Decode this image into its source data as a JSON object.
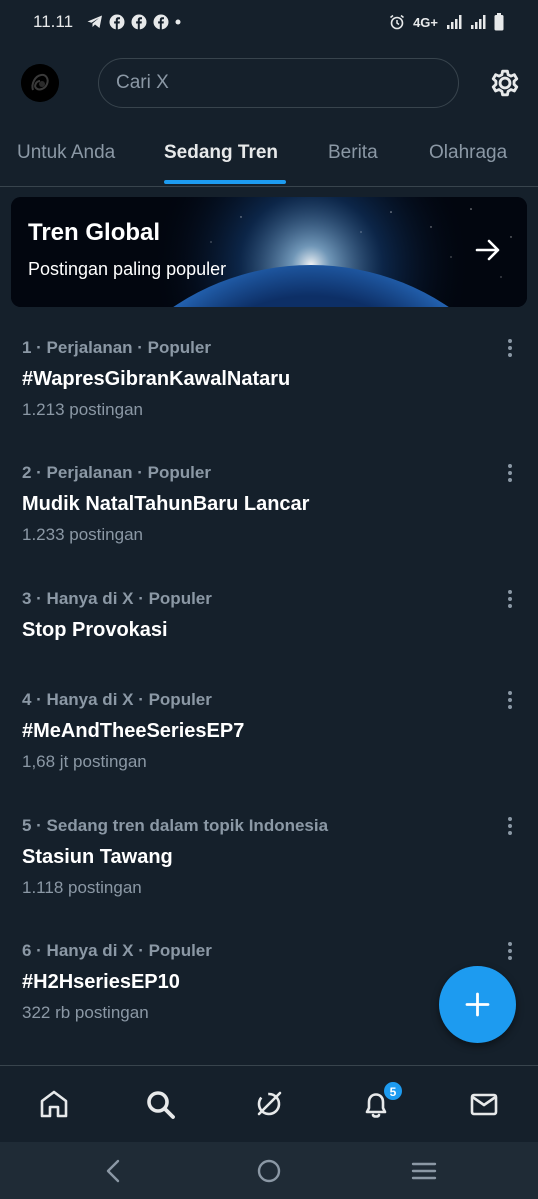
{
  "status_bar": {
    "time": "11.11",
    "icons": [
      "telegram-icon",
      "facebook-icon",
      "facebook-icon",
      "facebook-icon",
      "dot-icon"
    ],
    "right_icons": [
      "alarm-icon",
      "network-icon",
      "signal-icon",
      "signal-icon",
      "battery-icon"
    ],
    "network_label": "4G+"
  },
  "header": {
    "search_placeholder": "Cari X"
  },
  "tabs": [
    {
      "label": "Untuk Anda",
      "active": false
    },
    {
      "label": "Sedang Tren",
      "active": true
    },
    {
      "label": "Berita",
      "active": false
    },
    {
      "label": "Olahraga",
      "active": false
    }
  ],
  "banner": {
    "title": "Tren Global",
    "subtitle": "Postingan paling populer"
  },
  "trends": [
    {
      "meta": "1 · Perjalanan · Populer",
      "title": "#WapresGibranKawalNataru",
      "count": "1.213 postingan"
    },
    {
      "meta": "2 · Perjalanan · Populer",
      "title": "Mudik NatalTahunBaru Lancar",
      "count": "1.233 postingan"
    },
    {
      "meta": "3 · Hanya di X · Populer",
      "title": "Stop Provokasi",
      "count": ""
    },
    {
      "meta": "4 · Hanya di X · Populer",
      "title": "#MeAndTheeSeriesEP7",
      "count": "1,68 jt postingan"
    },
    {
      "meta": "5 · Sedang tren dalam topik Indonesia",
      "title": "Stasiun Tawang",
      "count": "1.118 postingan"
    },
    {
      "meta": "6 · Hanya di X · Populer",
      "title": "#H2HseriesEP10",
      "count": "322 rb postingan"
    }
  ],
  "bottom_nav": {
    "items": [
      "home-icon",
      "search-icon",
      "grok-icon",
      "notifications-icon",
      "messages-icon"
    ],
    "notification_badge": "5"
  },
  "colors": {
    "background": "#15202b",
    "accent": "#1d9bf0",
    "secondary_text": "#8b98a5",
    "divider": "#38444d"
  }
}
